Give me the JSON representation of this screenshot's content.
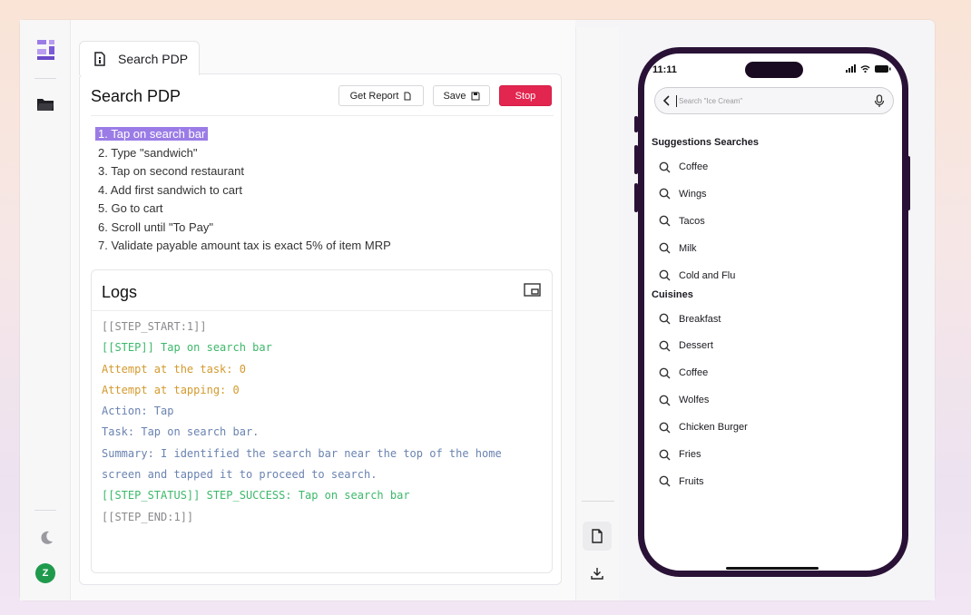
{
  "main": {
    "tab_label": "Search PDP",
    "card_title": "Search PDP",
    "buttons": {
      "report": "Get Report",
      "save": "Save",
      "stop": "Stop"
    },
    "steps": [
      "1. Tap on search bar",
      "2. Type \"sandwich\"",
      "3. Tap on second restaurant",
      "4. Add first sandwich to cart",
      "5. Go to cart",
      "6. Scroll until \"To Pay\"",
      "7. Validate payable amount tax is exact 5% of item MRP"
    ],
    "active_step_index": 0
  },
  "logs": {
    "title": "Logs",
    "lines": [
      {
        "text": "[[STEP_START:1]]",
        "color": "gray"
      },
      {
        "text": "[[STEP]] Tap on search bar",
        "color": "green"
      },
      {
        "text": "Attempt at the task: 0",
        "color": "orange"
      },
      {
        "text": "Attempt at tapping: 0",
        "color": "orange"
      },
      {
        "text": "Action: Tap",
        "color": "blue"
      },
      {
        "text": "Task: Tap on search bar.",
        "color": "blue"
      },
      {
        "text": "Summary: I identified the search bar near the top of the home",
        "color": "blue"
      },
      {
        "text": "screen and tapped it to proceed to search.",
        "color": "blue"
      },
      {
        "text": "[[STEP_STATUS]] STEP_SUCCESS: Tap on search bar",
        "color": "green"
      },
      {
        "text": "[[STEP_END:1]]",
        "color": "gray"
      }
    ]
  },
  "rail": {
    "avatar_initial": "Z"
  },
  "phone": {
    "time": "11:11",
    "search_placeholder": "Search \"Ice Cream\"",
    "sections": [
      {
        "title": "Suggestions Searches",
        "items": [
          "Coffee",
          "Wings",
          "Tacos",
          "Milk",
          "Cold and Flu"
        ]
      },
      {
        "title": "Cuisines",
        "items": [
          "Breakfast",
          "Dessert",
          "Coffee",
          "Wolfes",
          "Chicken Burger",
          "Fries",
          "Fruits"
        ]
      }
    ]
  },
  "colors": {
    "stop": "#e2264f",
    "highlight": "#9b7ce6",
    "phone_frame": "#2a1237",
    "avatar": "#1f9a4c"
  },
  "icons": [
    "app-logo-icon",
    "folder-icon",
    "moon-icon",
    "document-icon",
    "picture-in-picture-icon",
    "download-icon",
    "search-icon",
    "mic-icon",
    "chevron-left-icon"
  ]
}
